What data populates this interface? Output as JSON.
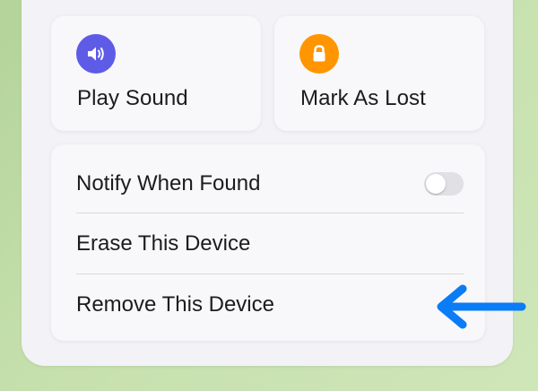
{
  "actions": {
    "play_sound": {
      "label": "Play Sound",
      "icon": "speaker-icon",
      "icon_color": "#5e5ce6"
    },
    "mark_as_lost": {
      "label": "Mark As Lost",
      "icon": "lock-icon",
      "icon_color": "#ff9500"
    }
  },
  "settings_list": {
    "items": [
      {
        "label": "Notify When Found",
        "control": "toggle",
        "toggle_on": false
      },
      {
        "label": "Erase This Device"
      },
      {
        "label": "Remove This Device"
      }
    ]
  },
  "annotation": {
    "icon": "left-arrow-icon",
    "color": "#0a7cf6"
  }
}
